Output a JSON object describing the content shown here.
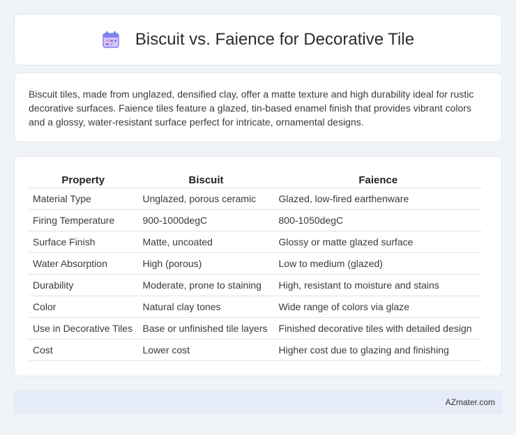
{
  "header": {
    "title": "Biscuit vs. Faience for Decorative Tile",
    "icon": "calendar-icon"
  },
  "description": "Biscuit tiles, made from unglazed, densified clay, offer a matte texture and high durability ideal for rustic decorative surfaces. Faience tiles feature a glazed, tin-based enamel finish that provides vibrant colors and a glossy, water-resistant surface perfect for intricate, ornamental designs.",
  "table": {
    "headers": [
      "Property",
      "Biscuit",
      "Faience"
    ],
    "rows": [
      [
        "Material Type",
        "Unglazed, porous ceramic",
        "Glazed, low-fired earthenware"
      ],
      [
        "Firing Temperature",
        "900-1000degC",
        "800-1050degC"
      ],
      [
        "Surface Finish",
        "Matte, uncoated",
        "Glossy or matte glazed surface"
      ],
      [
        "Water Absorption",
        "High (porous)",
        "Low to medium (glazed)"
      ],
      [
        "Durability",
        "Moderate, prone to staining",
        "High, resistant to moisture and stains"
      ],
      [
        "Color",
        "Natural clay tones",
        "Wide range of colors via glaze"
      ],
      [
        "Use in Decorative Tiles",
        "Base or unfinished tile layers",
        "Finished decorative tiles with detailed design"
      ],
      [
        "Cost",
        "Lower cost",
        "Higher cost due to glazing and finishing"
      ]
    ]
  },
  "footer": {
    "brand": "AZmater.com"
  },
  "colors": {
    "background": "#f0f3f8",
    "footer_bg": "#e6ecf7",
    "icon_accent": "#8a7ff0"
  }
}
